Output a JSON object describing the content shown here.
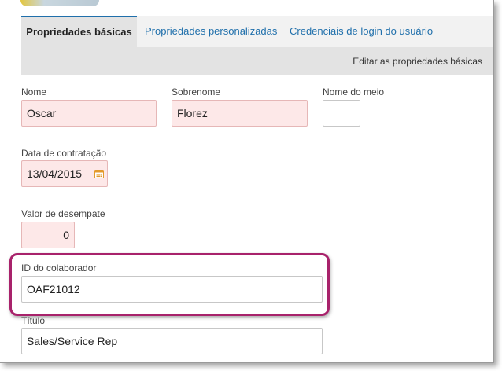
{
  "tabs": [
    {
      "label": "Propriedades básicas"
    },
    {
      "label": "Propriedades personalizadas"
    },
    {
      "label": "Credenciais de login do usuário"
    }
  ],
  "subbar": {
    "action_label": "Editar as propriedades básicas"
  },
  "form": {
    "first_name": {
      "label": "Nome",
      "value": "Oscar"
    },
    "last_name": {
      "label": "Sobrenome",
      "value": "Florez"
    },
    "middle_name": {
      "label": "Nome do meio",
      "value": ""
    },
    "hire_date": {
      "label": "Data de contratação",
      "value": "13/04/2015"
    },
    "tiebreaker": {
      "label": "Valor de desempate",
      "value": "0"
    },
    "employee_id": {
      "label": "ID do colaborador",
      "value": "OAF21012"
    },
    "title": {
      "label": "Título",
      "value": "Sales/Service Rep"
    }
  },
  "colors": {
    "accent": "#1f6fab",
    "required_bg": "#fde8e8",
    "highlight": "#a8226b",
    "calendar_icon": "#e39a2b"
  },
  "icons": {
    "calendar": "calendar-icon"
  }
}
